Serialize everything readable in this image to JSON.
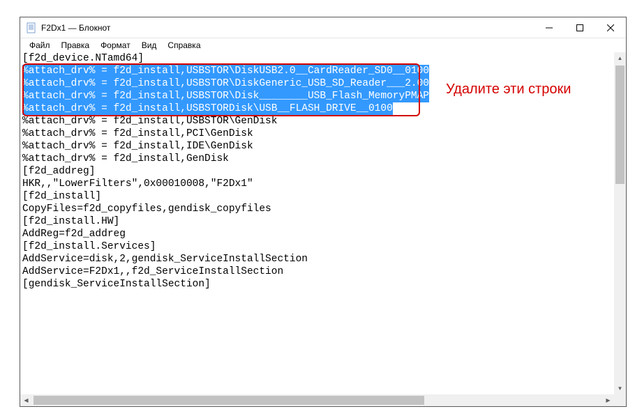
{
  "window": {
    "title": "F2Dx1 — Блокнот"
  },
  "menu": {
    "file": "Файл",
    "edit": "Правка",
    "format": "Формат",
    "view": "Вид",
    "help": "Справка"
  },
  "annotation": {
    "text": "Удалите эти строки"
  },
  "editor": {
    "line01": "[f2d_device.NTamd64]",
    "selected": [
      "%attach_drv% = f2d_install,USBSTOR\\DiskUSB2.0__CardReader_SD0__0100",
      "%attach_drv% = f2d_install,USBSTOR\\DiskGeneric_USB_SD_Reader___2.00",
      "%attach_drv% = f2d_install,USBSTOR\\Disk________USB_Flash_MemoryPMAP",
      "%attach_drv% = f2d_install,USBSTORDisk\\USB__FLASH_DRIVE__0100"
    ],
    "rest": [
      "%attach_drv% = f2d_install,USBSTOR\\GenDisk",
      "%attach_drv% = f2d_install,PCI\\GenDisk",
      "%attach_drv% = f2d_install,IDE\\GenDisk",
      "%attach_drv% = f2d_install,GenDisk",
      "",
      "[f2d_addreg]",
      "HKR,,\"LowerFilters\",0x00010008,\"F2Dx1\"",
      "",
      "[f2d_install]",
      "CopyFiles=f2d_copyfiles,gendisk_copyfiles",
      "",
      "[f2d_install.HW]",
      "AddReg=f2d_addreg",
      "",
      "[f2d_install.Services]",
      "AddService=disk,2,gendisk_ServiceInstallSection",
      "AddService=F2Dx1,,f2d_ServiceInstallSection",
      "",
      "[gendisk_ServiceInstallSection]"
    ]
  },
  "colors": {
    "selection_bg": "#3399ff",
    "annotation": "#d40000"
  }
}
